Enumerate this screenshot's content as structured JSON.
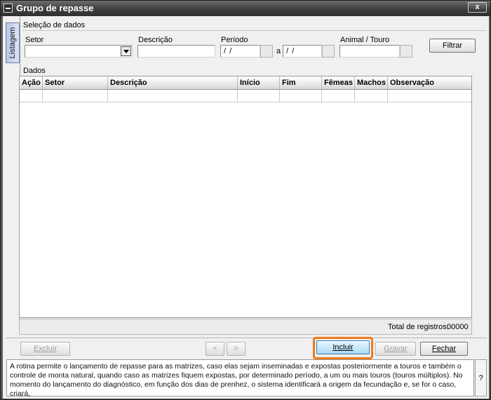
{
  "window": {
    "title": "Grupo de repasse",
    "close_label": "x"
  },
  "tab": {
    "label": "Listagem"
  },
  "selection": {
    "section_label": "Seleção de dados",
    "setor_label": "Setor",
    "setor_value": "",
    "descricao_label": "Descrição",
    "descricao_value": "",
    "periodo_label": "Período",
    "periodo_from": "/ /",
    "periodo_sep": "a",
    "periodo_to": "/ /",
    "animal_label": "Animal / Touro",
    "animal_value": "",
    "filter_button": "Filtrar"
  },
  "data_section": {
    "label": "Dados",
    "columns": [
      "Ação",
      "Setor",
      "Descrição",
      "Início",
      "Fim",
      "Fêmeas",
      "Machos",
      "Observação"
    ],
    "rows": [],
    "total_label": "Total de registros:",
    "total_value": "00000"
  },
  "actions": {
    "excluir": "Excluir",
    "prev": "<",
    "next": ">",
    "incluir": "Incluir",
    "gravar": "Gravar",
    "fechar": "Fechar"
  },
  "help": {
    "text": "A rotina permite o lançamento de repasse para as matrizes, caso elas sejam inseminadas e expostas posteriormente a touros e também o controle de monta natural, quando caso as matrizes fiquem expostas, por determinado período, a um ou mais touros (touros múltiplos). No momento do lançamento do diagnóstico, em função dos dias de prenhez, o sistema identificará a origem da fecundação e, se for o caso, criará,",
    "button": "?"
  },
  "colors": {
    "highlight": "#f07a1a",
    "tab_bg": "#c9d2ee",
    "titlebar": "#3e3e3e"
  }
}
